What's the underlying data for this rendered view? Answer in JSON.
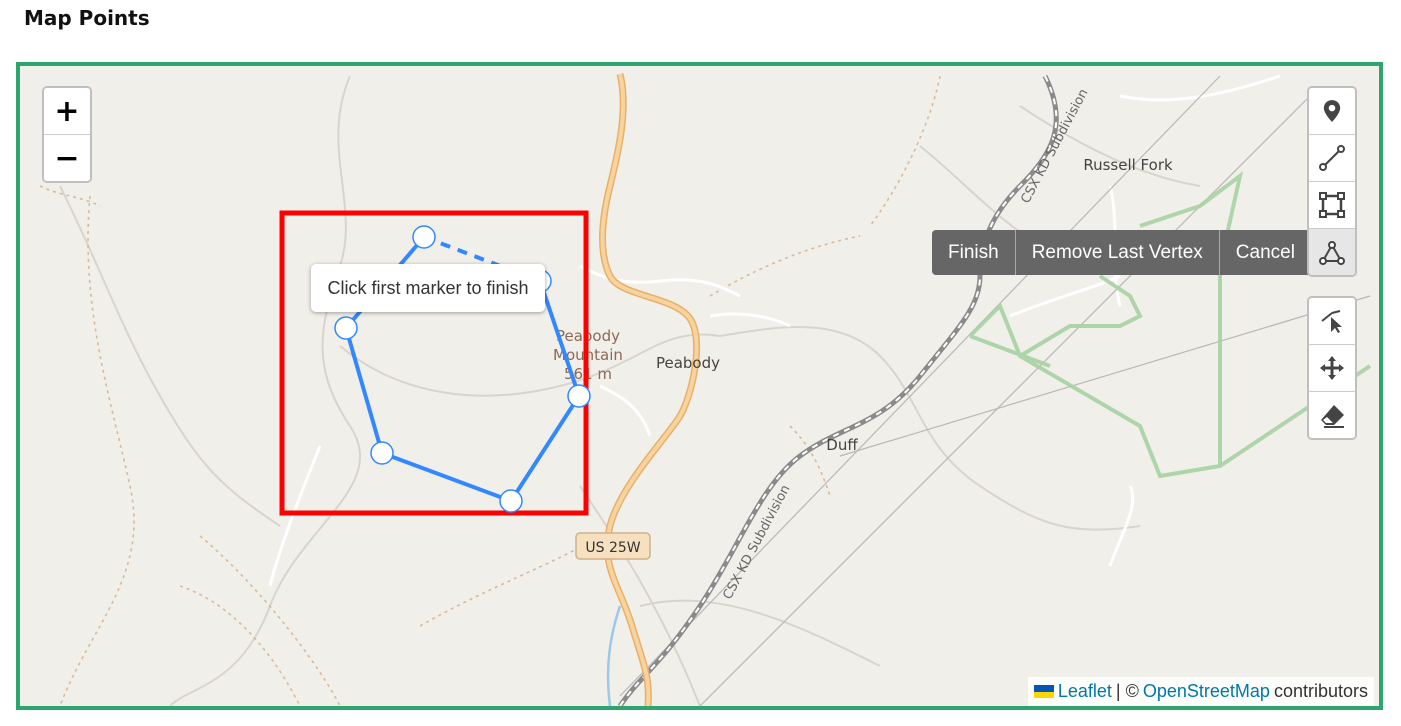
{
  "page": {
    "title": "Map Points"
  },
  "colors": {
    "frame_border": "#2ea56e",
    "map_bg": "#f1efe9",
    "road_major": "#f5c27a",
    "draw_line": "#3388ff",
    "highlight_box": "#ff0000",
    "railway": "#7a7a7a"
  },
  "zoom": {
    "in_label": "+",
    "out_label": "−"
  },
  "draw_toolbar": {
    "tools": [
      "marker-icon",
      "polyline-icon",
      "rectangle-icon",
      "polygon-icon"
    ],
    "active": "polygon-icon"
  },
  "edit_toolbar": {
    "tools": [
      "edit-icon",
      "move-icon",
      "eraser-icon"
    ]
  },
  "draw_actions": {
    "finish": "Finish",
    "remove_last": "Remove Last Vertex",
    "cancel": "Cancel"
  },
  "tooltip": {
    "text": "Click first marker to finish"
  },
  "map_labels": {
    "peabody_mountain_1": "Peabody",
    "peabody_mountain_2": "Mountain",
    "peabody_mountain_3": "561 m",
    "peabody": "Peabody",
    "duff": "Duff",
    "russell_fork": "Russell Fork",
    "csx_upper": "CSX KD Subdivision",
    "csx_lower": "CSX KD Subdivision",
    "us25w": "US 25W"
  },
  "attribution": {
    "leaflet": "Leaflet",
    "separator": "| ©",
    "osm": "OpenStreetMap",
    "suffix": "contributors"
  }
}
